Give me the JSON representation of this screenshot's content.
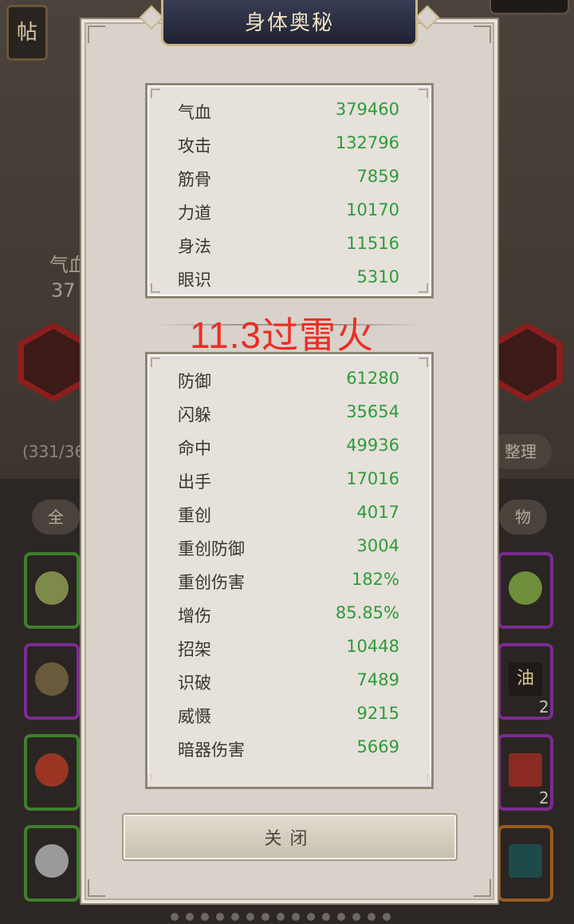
{
  "background": {
    "tag_left": "帖",
    "stat_partial": "气血",
    "stat_value_partial": "37",
    "count_text": "(331/36",
    "right_label": "整理",
    "tab_left": "全",
    "tab_right": "物",
    "slot_count_1": "2",
    "slot_count_2": "2",
    "oil_label": "油"
  },
  "modal": {
    "title": "身体奥秘",
    "top_stats": [
      {
        "label": "气血",
        "value": "379460"
      },
      {
        "label": "攻击",
        "value": "132796"
      },
      {
        "label": "筋骨",
        "value": "7859"
      },
      {
        "label": "力道",
        "value": "10170"
      },
      {
        "label": "身法",
        "value": "11516"
      },
      {
        "label": "眼识",
        "value": "5310"
      }
    ],
    "overlay_text": "11.3过雷火",
    "bottom_stats": [
      {
        "label": "防御",
        "value": "61280"
      },
      {
        "label": "闪躲",
        "value": "35654"
      },
      {
        "label": "命中",
        "value": "49936"
      },
      {
        "label": "出手",
        "value": "17016"
      },
      {
        "label": "重创",
        "value": "4017"
      },
      {
        "label": "重创防御",
        "value": "3004"
      },
      {
        "label": "重创伤害",
        "value": "182%"
      },
      {
        "label": "增伤",
        "value": "85.85%"
      },
      {
        "label": "招架",
        "value": "10448"
      },
      {
        "label": "识破",
        "value": "7489"
      },
      {
        "label": "威慑",
        "value": "9215"
      },
      {
        "label": "暗器伤害",
        "value": "5669"
      }
    ],
    "close_label": "关闭",
    "colors": {
      "value_green": "#2e9b3a",
      "overlay_red": "#ec2d24"
    }
  }
}
